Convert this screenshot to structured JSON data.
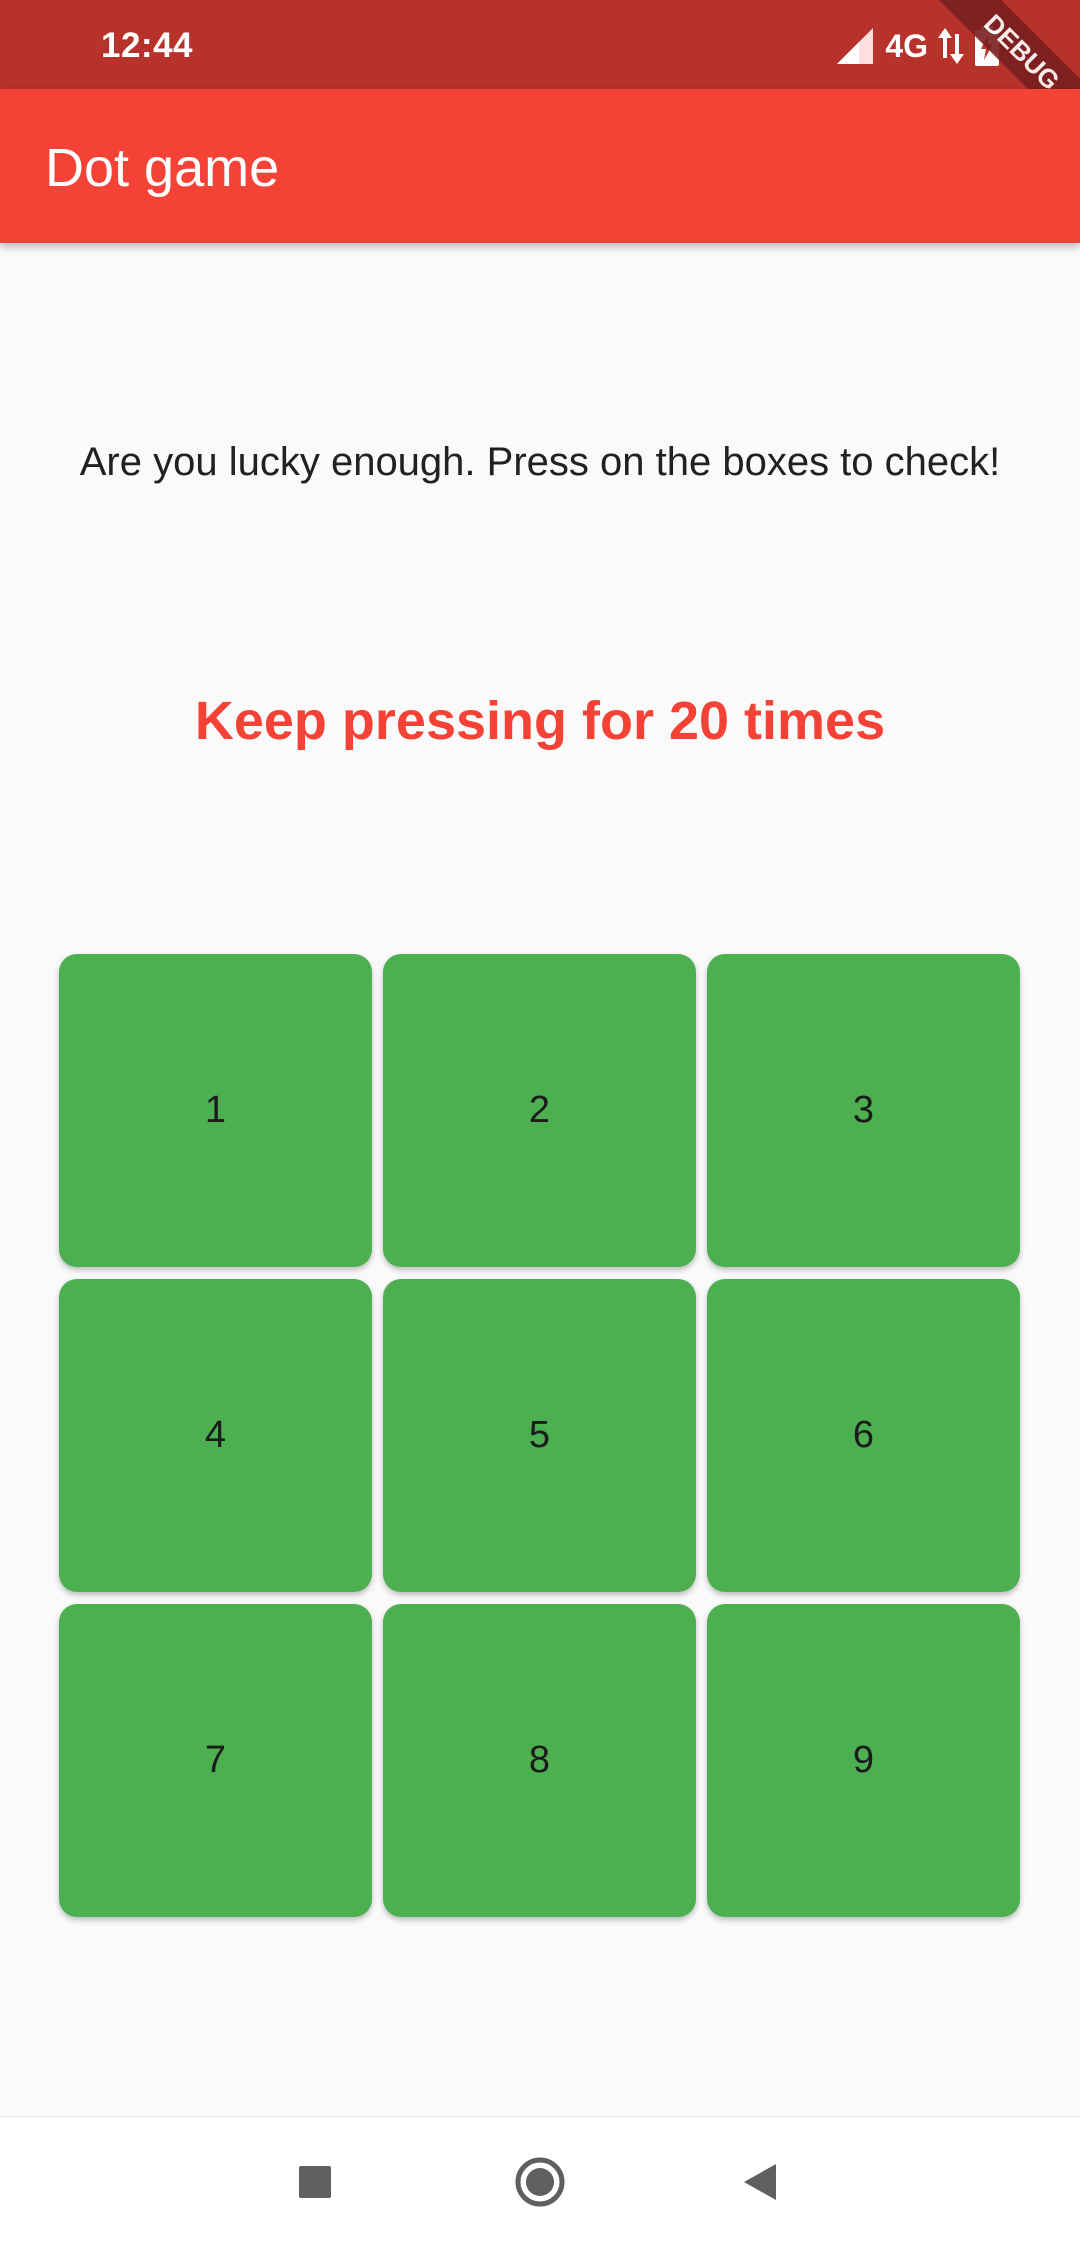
{
  "status_bar": {
    "time": "12:44",
    "network": "4G",
    "debug_label": "DEBUG"
  },
  "app_bar": {
    "title": "Dot game"
  },
  "main": {
    "instructions": "Are you lucky enough. Press on the boxes to check!",
    "counter": "Keep pressing for 20 times"
  },
  "boxes": [
    "1",
    "2",
    "3",
    "4",
    "5",
    "6",
    "7",
    "8",
    "9"
  ],
  "colors": {
    "status_bar": "#b7322a",
    "app_bar": "#f44336",
    "box": "#4caf50",
    "counter_text": "#f44336"
  },
  "nav_bar": {
    "icons": [
      "recents-icon",
      "home-icon",
      "back-icon"
    ]
  }
}
